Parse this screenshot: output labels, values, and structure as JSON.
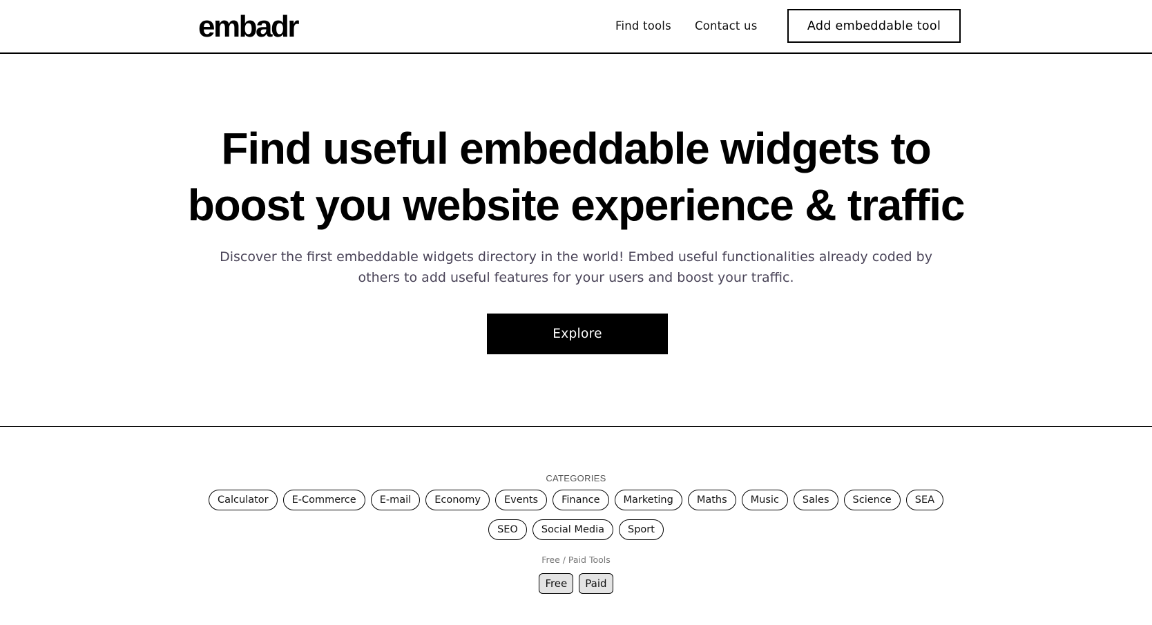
{
  "header": {
    "logo": "embadr",
    "nav": [
      {
        "label": "Find tools"
      },
      {
        "label": "Contact us"
      }
    ],
    "cta_label": "Add embeddable tool"
  },
  "hero": {
    "headline_line1": "Find useful embeddable widgets to",
    "headline_line2": "boost you website experience & traffic",
    "subtitle_line1": "Discover the first embeddable widgets directory in the world! Embed useful functionalities already coded by",
    "subtitle_line2": "others to add useful features for your users and boost your traffic.",
    "explore_label": "Explore"
  },
  "filters": {
    "categories_label": "CATEGORIES",
    "categories_row1": [
      "Calculator",
      "E-Commerce",
      "E-mail",
      "Economy",
      "Events",
      "Finance",
      "Marketing",
      "Maths",
      "Music",
      "Sales",
      "Science",
      "SEA"
    ],
    "categories_row2": [
      "SEO",
      "Social Media",
      "Sport"
    ],
    "pricing_label": "Free / Paid Tools",
    "pricing_options": [
      "Free",
      "Paid"
    ]
  }
}
